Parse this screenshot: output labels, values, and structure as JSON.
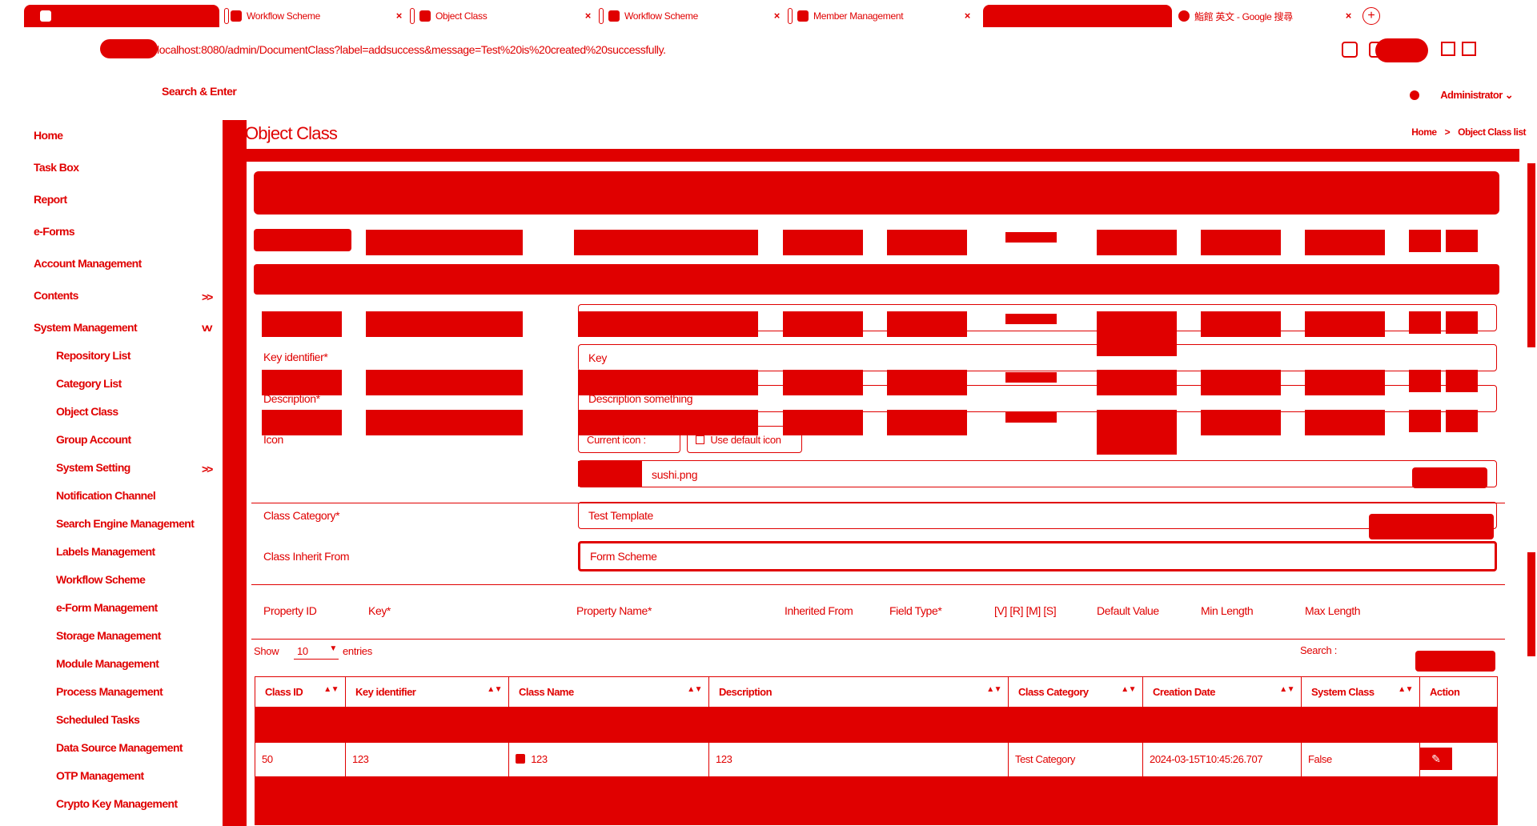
{
  "browser": {
    "tabs": [
      {
        "label": ""
      },
      {
        "label": "Workflow Scheme"
      },
      {
        "label": "Object Class"
      },
      {
        "label": "Workflow Scheme"
      },
      {
        "label": "Member Management"
      },
      {
        "label": ""
      },
      {
        "label": "鮨館 英文 - Google 搜尋"
      }
    ],
    "close_glyph": "×",
    "new_tab_glyph": "+",
    "url": "localhost:8080/admin/DocumentClass?label=addsuccess&message=Test%20is%20created%20successfully."
  },
  "header": {
    "search_label": "Search & Enter",
    "user_name": "Administrator",
    "user_chevron": "⌄"
  },
  "sidebar": {
    "items": [
      {
        "label": "Home"
      },
      {
        "label": "Task Box"
      },
      {
        "label": "Report"
      },
      {
        "label": "e-Forms"
      },
      {
        "label": "Account Management"
      },
      {
        "label": "Contents",
        "chevron": ">>"
      },
      {
        "label": "System Management",
        "chevron": "vv"
      }
    ],
    "subitems": [
      {
        "label": "Repository List"
      },
      {
        "label": "Category List"
      },
      {
        "label": "Object Class"
      },
      {
        "label": "Group Account"
      },
      {
        "label": "System Setting",
        "chevron": ">>"
      },
      {
        "label": "Notification Channel"
      },
      {
        "label": "Search Engine Management"
      },
      {
        "label": "Labels Management"
      },
      {
        "label": "Workflow Scheme"
      },
      {
        "label": "e-Form Management"
      },
      {
        "label": "Storage Management"
      },
      {
        "label": "Module Management"
      },
      {
        "label": "Process Management"
      },
      {
        "label": "Scheduled Tasks"
      },
      {
        "label": "Data Source Management"
      },
      {
        "label": "OTP Management"
      },
      {
        "label": "Crypto Key Management"
      }
    ]
  },
  "page": {
    "title": "Object Class",
    "breadcrumb": {
      "home": "Home",
      "separator": ">",
      "current": "Object Class list"
    }
  },
  "form": {
    "key_label": "Key identifier*",
    "key_value": "Key",
    "description_label": "Description*",
    "description_value": "Description something",
    "icon_label": "Icon",
    "current_icon_label": "Current icon :",
    "use_default_icon_label": "Use default icon",
    "file_name": "sushi.png",
    "category_label": "Class Category*",
    "category_value": "Test Template",
    "inherit_label": "Class Inherit From",
    "inherit_value": "Form Scheme"
  },
  "properties": {
    "headers": [
      "Property ID",
      "Key*",
      "Property Name*",
      "Inherited From",
      "Field Type*",
      "[V] [R] [M] [S]",
      "Default Value",
      "Min Length",
      "Max Length"
    ]
  },
  "list": {
    "show_label": "Show",
    "page_size": "10",
    "entries_label": "entries",
    "search_label": "Search :",
    "columns": [
      "Class ID",
      "Key identifier",
      "Class Name",
      "Description",
      "Class Category",
      "Creation Date",
      "System Class",
      "Action"
    ],
    "rows": [
      {
        "class_id": "50",
        "key_identifier": "123",
        "class_name": "123",
        "description": "123",
        "class_category": "Test Category",
        "creation_date": "2024-03-15T10:45:26.707",
        "system_class": "False",
        "action_glyph": "✎"
      }
    ]
  },
  "colors": {
    "accent": "#e00000",
    "background": "#ffffff"
  }
}
